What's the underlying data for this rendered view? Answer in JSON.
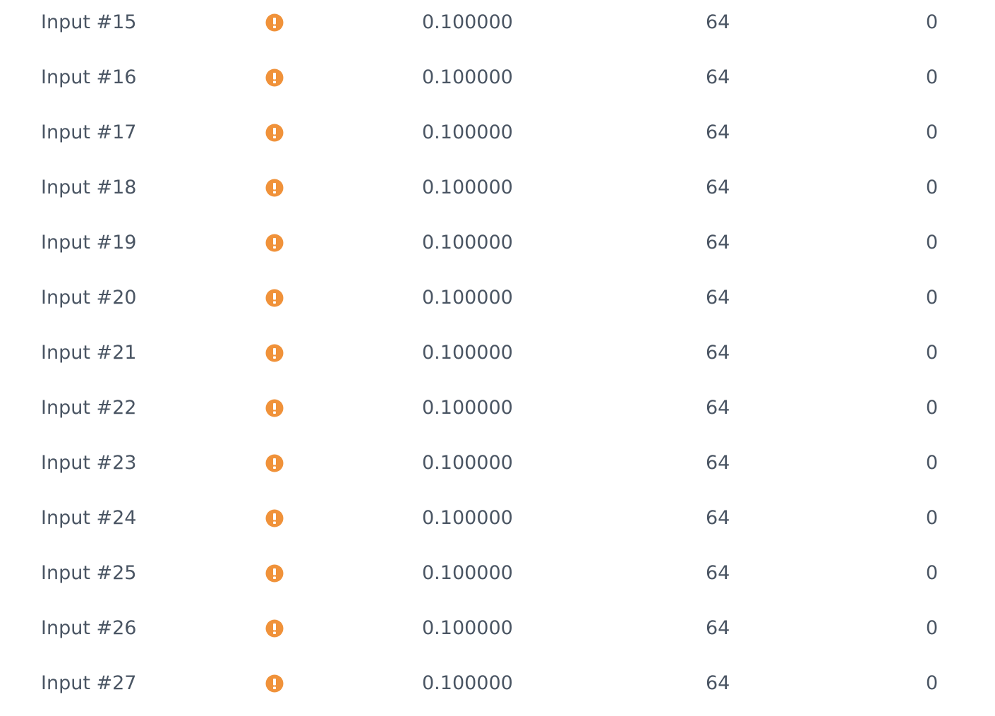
{
  "colors": {
    "text": "#4a5563",
    "warning": "#f0923a"
  },
  "icons": {
    "status": "warning-icon"
  },
  "rows": [
    {
      "name": "Input #15",
      "value": "0.100000",
      "count": "64",
      "last": "0"
    },
    {
      "name": "Input #16",
      "value": "0.100000",
      "count": "64",
      "last": "0"
    },
    {
      "name": "Input #17",
      "value": "0.100000",
      "count": "64",
      "last": "0"
    },
    {
      "name": "Input #18",
      "value": "0.100000",
      "count": "64",
      "last": "0"
    },
    {
      "name": "Input #19",
      "value": "0.100000",
      "count": "64",
      "last": "0"
    },
    {
      "name": "Input #20",
      "value": "0.100000",
      "count": "64",
      "last": "0"
    },
    {
      "name": "Input #21",
      "value": "0.100000",
      "count": "64",
      "last": "0"
    },
    {
      "name": "Input #22",
      "value": "0.100000",
      "count": "64",
      "last": "0"
    },
    {
      "name": "Input #23",
      "value": "0.100000",
      "count": "64",
      "last": "0"
    },
    {
      "name": "Input #24",
      "value": "0.100000",
      "count": "64",
      "last": "0"
    },
    {
      "name": "Input #25",
      "value": "0.100000",
      "count": "64",
      "last": "0"
    },
    {
      "name": "Input #26",
      "value": "0.100000",
      "count": "64",
      "last": "0"
    },
    {
      "name": "Input #27",
      "value": "0.100000",
      "count": "64",
      "last": "0"
    }
  ]
}
